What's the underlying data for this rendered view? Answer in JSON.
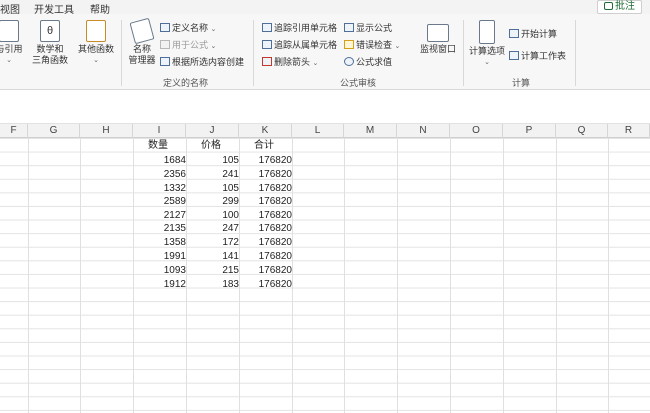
{
  "menu": {
    "items": [
      "视图",
      "开发工具",
      "帮助"
    ],
    "comment_label": "批注"
  },
  "ribbon": {
    "func_group": {
      "lookup_label": "与引用",
      "math_label_1": "数学和",
      "math_label_2": "三角函数",
      "other_label": "其他函数"
    },
    "defined_names": {
      "name_manager_1": "名称",
      "name_manager_2": "管理器",
      "define_name": "定义名称",
      "use_in_formula": "用于公式",
      "create_from_selection": "根据所选内容创建",
      "group_label": "定义的名称"
    },
    "formula_audit": {
      "trace_precedents": "追踪引用单元格",
      "trace_dependents": "追踪从属单元格",
      "remove_arrows": "删除箭头",
      "show_formulas": "显示公式",
      "error_checking": "错误检查",
      "evaluate_formula": "公式求值",
      "watch_window": "监视窗口",
      "group_label": "公式审核"
    },
    "calculation": {
      "calc_options": "计算选项",
      "calc_now": "开始计算",
      "calc_sheet": "计算工作表",
      "group_label": "计算"
    }
  },
  "grid": {
    "columns": [
      "F",
      "G",
      "H",
      "I",
      "J",
      "K",
      "L",
      "M",
      "N",
      "O",
      "P",
      "Q",
      "R"
    ],
    "headers": {
      "I": "数量",
      "J": "价格",
      "K": "合计"
    },
    "rows": [
      {
        "qty": "1684",
        "price": "105",
        "total": "176820"
      },
      {
        "qty": "2356",
        "price": "241",
        "total": "176820"
      },
      {
        "qty": "1332",
        "price": "105",
        "total": "176820"
      },
      {
        "qty": "2589",
        "price": "299",
        "total": "176820"
      },
      {
        "qty": "2127",
        "price": "100",
        "total": "176820"
      },
      {
        "qty": "2135",
        "price": "247",
        "total": "176820"
      },
      {
        "qty": "1358",
        "price": "172",
        "total": "176820"
      },
      {
        "qty": "1991",
        "price": "141",
        "total": "176820"
      },
      {
        "qty": "1093",
        "price": "215",
        "total": "176820"
      },
      {
        "qty": "1912",
        "price": "183",
        "total": "176820"
      }
    ]
  }
}
